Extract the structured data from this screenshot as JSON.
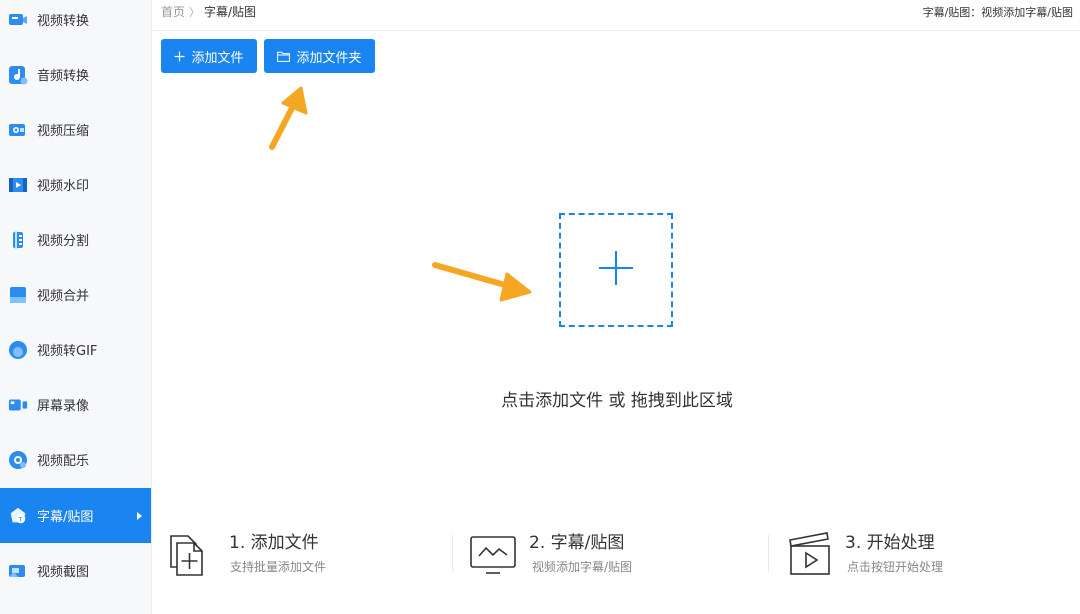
{
  "sidebar": {
    "items": [
      {
        "label": "视频转换",
        "icon": "video-convert-icon"
      },
      {
        "label": "音频转换",
        "icon": "audio-convert-icon"
      },
      {
        "label": "视频压缩",
        "icon": "video-compress-icon"
      },
      {
        "label": "视频水印",
        "icon": "video-watermark-icon"
      },
      {
        "label": "视频分割",
        "icon": "video-split-icon"
      },
      {
        "label": "视频合并",
        "icon": "video-merge-icon"
      },
      {
        "label": "视频转GIF",
        "icon": "video-gif-icon"
      },
      {
        "label": "屏幕录像",
        "icon": "screen-record-icon"
      },
      {
        "label": "视频配乐",
        "icon": "video-music-icon"
      },
      {
        "label": "字幕/贴图",
        "icon": "subtitle-sticker-icon",
        "active": true
      },
      {
        "label": "视频截图",
        "icon": "video-screenshot-icon"
      }
    ]
  },
  "header": {
    "breadcrumb_home": "首页",
    "breadcrumb_sep": "〉",
    "breadcrumb_current": "字幕/贴图",
    "description": "字幕/贴图：视频添加字幕/贴图"
  },
  "toolbar": {
    "add_file_label": "添加文件",
    "add_folder_label": "添加文件夹"
  },
  "dropzone": {
    "hint": "点击添加文件 或 拖拽到此区域"
  },
  "steps": [
    {
      "title": "1. 添加文件",
      "desc": "支持批量添加文件",
      "icon": "add-file-icon"
    },
    {
      "title": "2. 字幕/贴图",
      "desc": "视频添加字幕/贴图",
      "icon": "monitor-icon"
    },
    {
      "title": "3. 开始处理",
      "desc": "点击按钮开始处理",
      "icon": "clapper-play-icon"
    }
  ],
  "colors": {
    "accent": "#1a85f0",
    "sidebar_bg": "#f7f8fa",
    "annotation_arrow": "#f5a623"
  }
}
